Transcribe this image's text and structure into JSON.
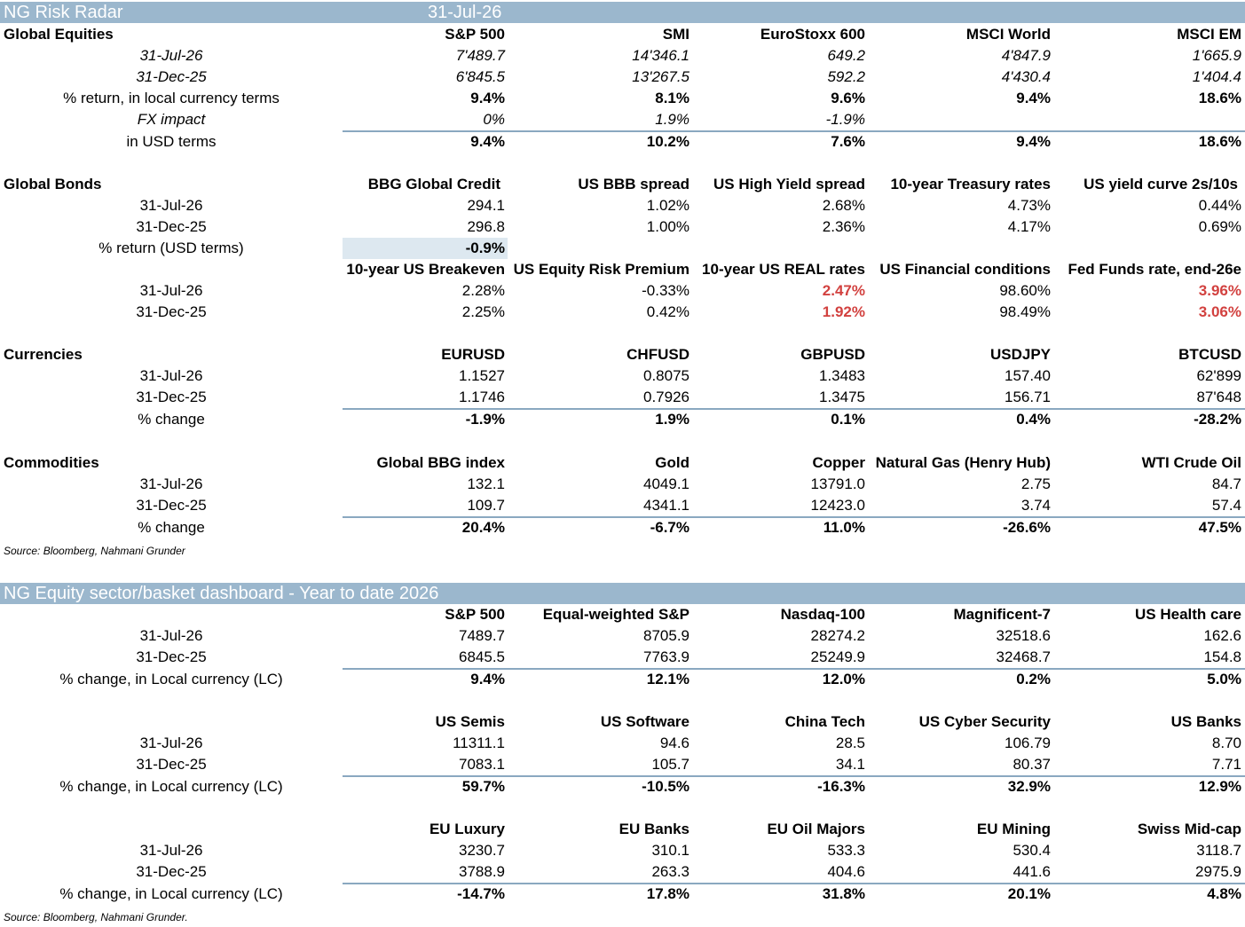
{
  "radar": {
    "title": "NG Risk Radar",
    "date": "31-Jul-26",
    "equities": {
      "section": "Global Equities",
      "cols": [
        "S&P 500",
        "SMI",
        "EuroStoxx 600",
        "MSCI World",
        "MSCI EM"
      ],
      "rows": [
        {
          "label": "31-Jul-26",
          "v": [
            "7'489.7",
            "14'346.1",
            "649.2",
            "4'847.9",
            "1'665.9"
          ]
        },
        {
          "label": "31-Dec-25",
          "v": [
            "6'845.5",
            "13'267.5",
            "592.2",
            "4'430.4",
            "1'404.4"
          ]
        },
        {
          "label": "% return, in local currency terms",
          "v": [
            "9.4%",
            "8.1%",
            "9.6%",
            "9.4%",
            "18.6%"
          ]
        },
        {
          "label": "FX impact",
          "v": [
            "0%",
            "1.9%",
            "-1.9%",
            "",
            ""
          ]
        },
        {
          "label": "in USD terms",
          "v": [
            "9.4%",
            "10.2%",
            "7.6%",
            "9.4%",
            "18.6%"
          ]
        }
      ]
    },
    "bonds": {
      "section": "Global Bonds",
      "cols": [
        "BBG Global Credit",
        "US BBB spread",
        "US High Yield spread",
        "10-year Treasury rates",
        "US yield curve 2s/10s"
      ],
      "rows": [
        {
          "label": "31-Jul-26",
          "v": [
            "294.1",
            "1.02%",
            "2.68%",
            "4.73%",
            "0.44%"
          ]
        },
        {
          "label": "31-Dec-25",
          "v": [
            "296.8",
            "1.00%",
            "2.36%",
            "4.17%",
            "0.69%"
          ]
        },
        {
          "label": "% return (USD terms)",
          "v": [
            "-0.9%",
            "",
            "",
            "",
            ""
          ]
        }
      ],
      "cols2": [
        "10-year US Breakeven",
        "US Equity Risk Premium",
        "10-year US REAL rates",
        "US Financial conditions",
        "Fed Funds rate, end-26e"
      ],
      "rows2": [
        {
          "label": "31-Jul-26",
          "v": [
            "2.28%",
            "-0.33%",
            "2.47%",
            "98.60%",
            "3.96%"
          ]
        },
        {
          "label": "31-Dec-25",
          "v": [
            "2.25%",
            "0.42%",
            "1.92%",
            "98.49%",
            "3.06%"
          ]
        }
      ]
    },
    "currencies": {
      "section": "Currencies",
      "cols": [
        "EURUSD",
        "CHFUSD",
        "GBPUSD",
        "USDJPY",
        "BTCUSD"
      ],
      "rows": [
        {
          "label": "31-Jul-26",
          "v": [
            "1.1527",
            "0.8075",
            "1.3483",
            "157.40",
            "62'899"
          ]
        },
        {
          "label": "31-Dec-25",
          "v": [
            "1.1746",
            "0.7926",
            "1.3475",
            "156.71",
            "87'648"
          ]
        },
        {
          "label": "% change",
          "v": [
            "-1.9%",
            "1.9%",
            "0.1%",
            "0.4%",
            "-28.2%"
          ]
        }
      ]
    },
    "commodities": {
      "section": "Commodities",
      "cols": [
        "Global BBG index",
        "Gold",
        "Copper",
        "Natural Gas (Henry Hub)",
        "WTI Crude Oil"
      ],
      "rows": [
        {
          "label": "31-Jul-26",
          "v": [
            "132.1",
            "4049.1",
            "13791.0",
            "2.75",
            "84.7"
          ]
        },
        {
          "label": "31-Dec-25",
          "v": [
            "109.7",
            "4341.1",
            "12423.0",
            "3.74",
            "57.4"
          ]
        },
        {
          "label": "% change",
          "v": [
            "20.4%",
            "-6.7%",
            "11.0%",
            "-26.6%",
            "47.5%"
          ]
        }
      ]
    },
    "source": "Source: Bloomberg, Nahmani Grunder"
  },
  "dashboard": {
    "title": "NG Equity sector/basket dashboard - Year to date 2026",
    "blocks": [
      {
        "cols": [
          "S&P 500",
          "Equal-weighted S&P",
          "Nasdaq-100",
          "Magnificent-7",
          "US Health care"
        ],
        "rows": [
          {
            "label": "31-Jul-26",
            "v": [
              "7489.7",
              "8705.9",
              "28274.2",
              "32518.6",
              "162.6"
            ]
          },
          {
            "label": "31-Dec-25",
            "v": [
              "6845.5",
              "7763.9",
              "25249.9",
              "32468.7",
              "154.8"
            ]
          },
          {
            "label": "% change, in Local currency (LC)",
            "v": [
              "9.4%",
              "12.1%",
              "12.0%",
              "0.2%",
              "5.0%"
            ]
          }
        ]
      },
      {
        "cols": [
          "US Semis",
          "US Software",
          "China Tech",
          "US Cyber Security",
          "US Banks"
        ],
        "rows": [
          {
            "label": "31-Jul-26",
            "v": [
              "11311.1",
              "94.6",
              "28.5",
              "106.79",
              "8.70"
            ]
          },
          {
            "label": "31-Dec-25",
            "v": [
              "7083.1",
              "105.7",
              "34.1",
              "80.37",
              "7.71"
            ]
          },
          {
            "label": "% change, in Local currency (LC)",
            "v": [
              "59.7%",
              "-10.5%",
              "-16.3%",
              "32.9%",
              "12.9%"
            ]
          }
        ]
      },
      {
        "cols": [
          "EU Luxury",
          "EU Banks",
          "EU Oil Majors",
          "EU Mining",
          "Swiss Mid-cap"
        ],
        "rows": [
          {
            "label": "31-Jul-26",
            "v": [
              "3230.7",
              "310.1",
              "533.3",
              "530.4",
              "3118.7"
            ]
          },
          {
            "label": "31-Dec-25",
            "v": [
              "3788.9",
              "263.3",
              "404.6",
              "441.6",
              "2975.9"
            ]
          },
          {
            "label": "% change, in Local currency (LC)",
            "v": [
              "-14.7%",
              "17.8%",
              "31.8%",
              "20.1%",
              "4.8%"
            ]
          }
        ]
      }
    ],
    "source": "Source: Bloomberg, Nahmani Grunder."
  },
  "colors": {
    "band": "#9bb7cd",
    "rule": "#8aa8c0",
    "highlight": "#dde8f0",
    "red": "#d2413f"
  }
}
